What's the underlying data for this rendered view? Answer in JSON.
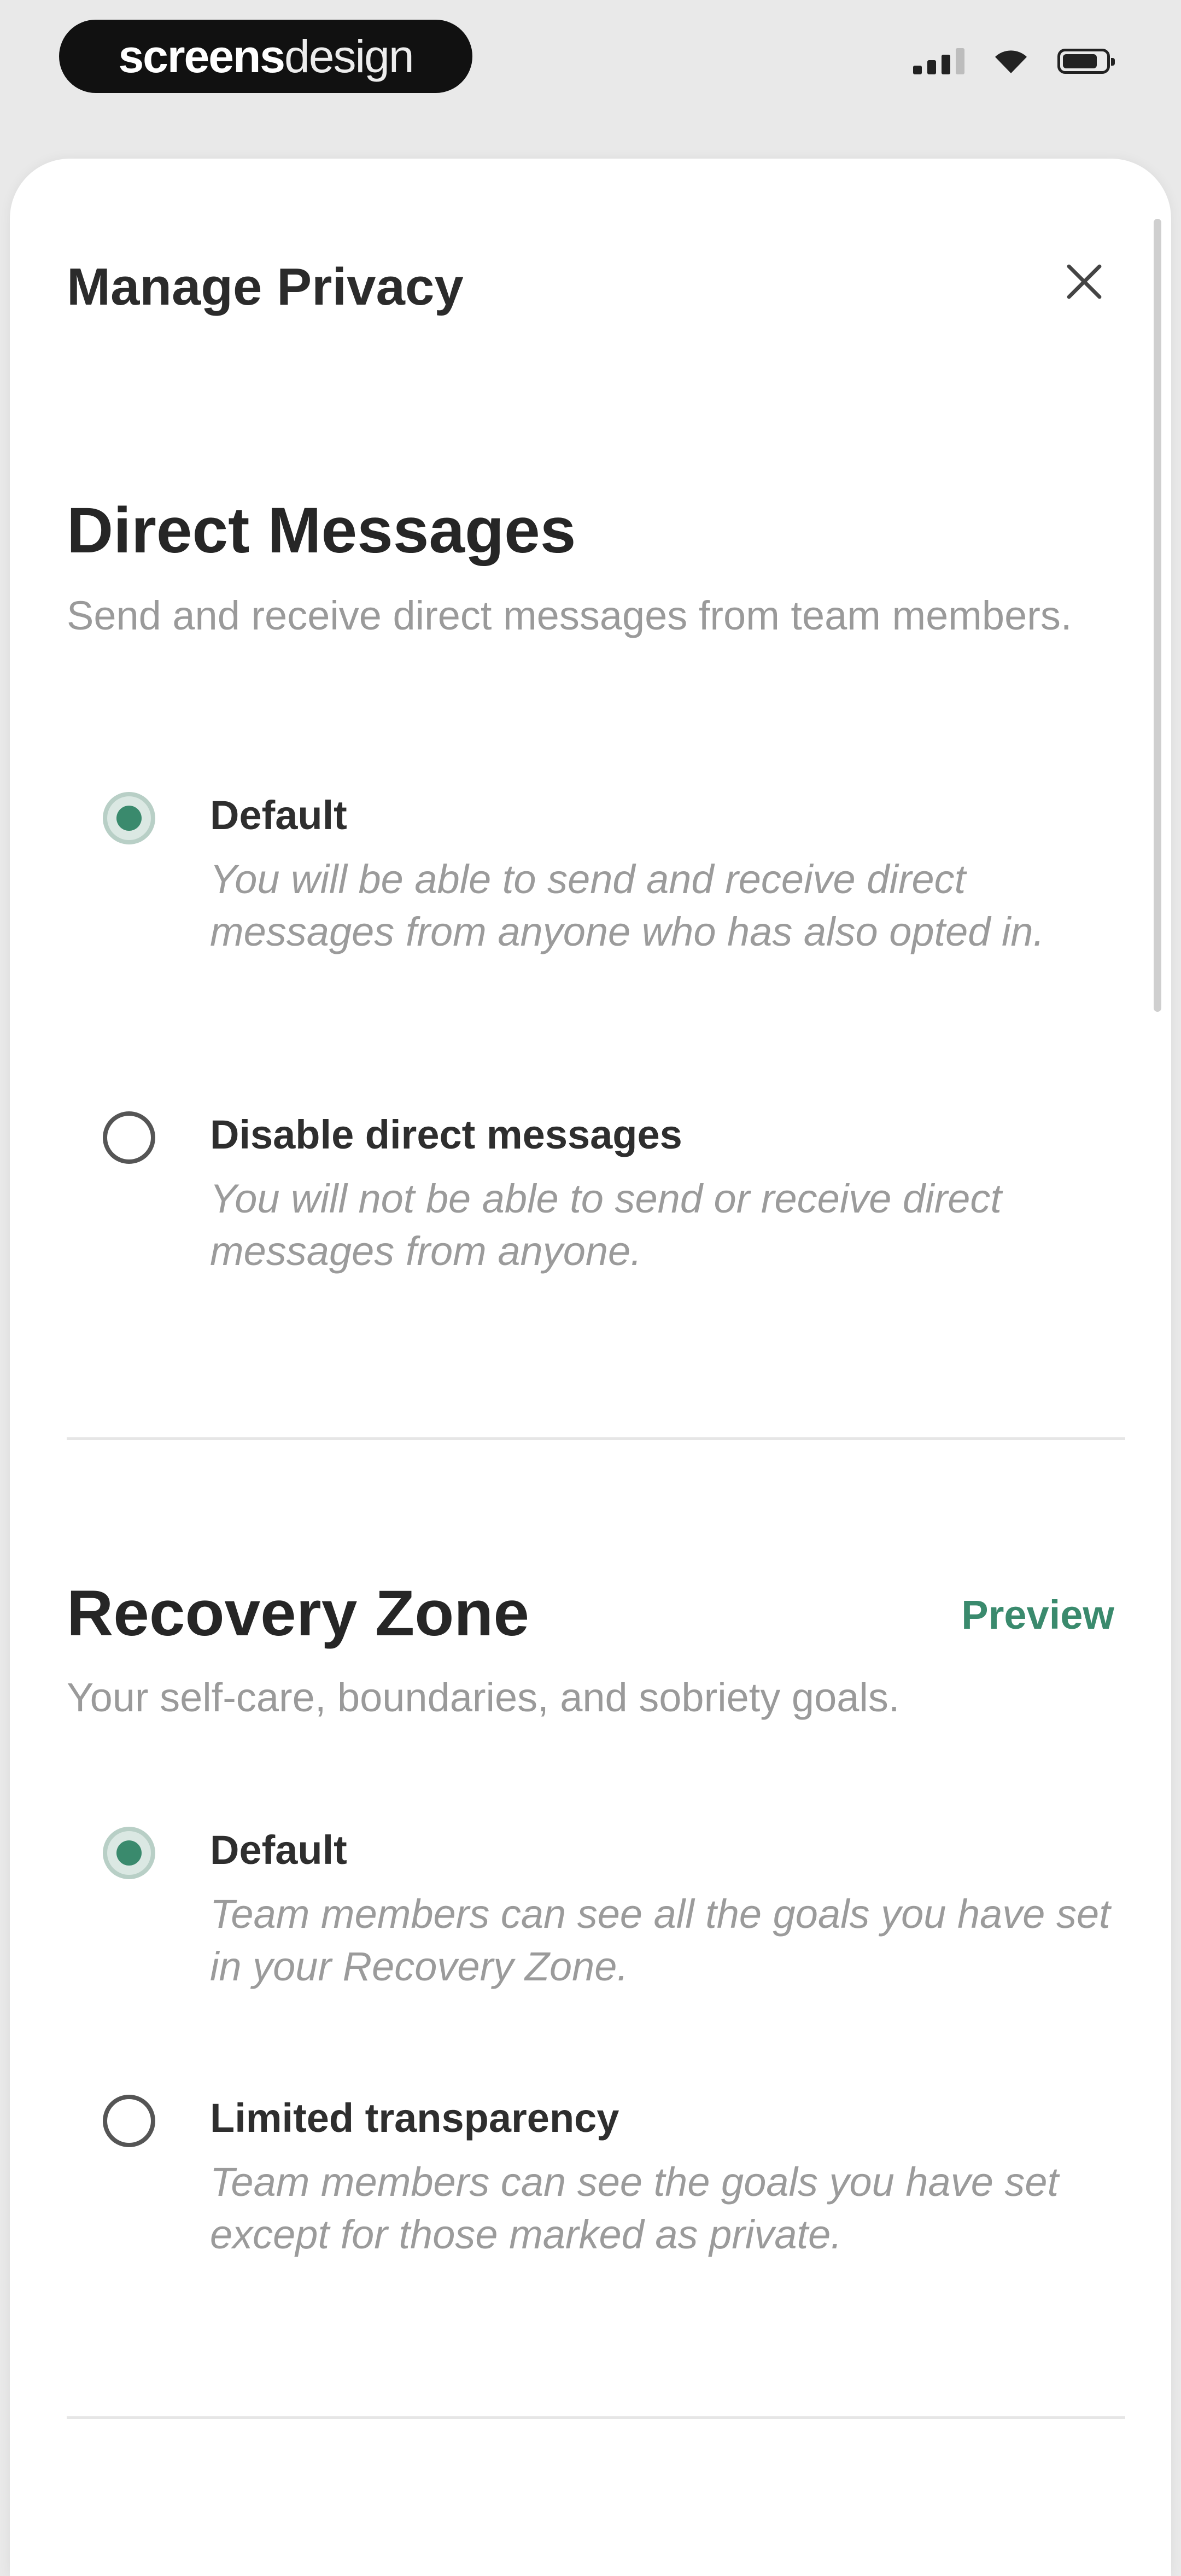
{
  "status_bar": {
    "brand_bold": "screens",
    "brand_light": "design"
  },
  "header": {
    "title": "Manage Privacy",
    "close_icon": "close-icon"
  },
  "sections": [
    {
      "title": "Direct Messages",
      "subtitle": "Send and receive direct messages from team members.",
      "options": [
        {
          "label": "Default",
          "description": "You will be able to send and receive direct messages from anyone who has also opted in.",
          "selected": true
        },
        {
          "label": "Disable direct messages",
          "description": "You will not be able to send or receive direct messages from anyone.",
          "selected": false
        }
      ]
    },
    {
      "title": "Recovery Zone",
      "action": "Preview",
      "subtitle": "Your self-care, boundaries, and sobriety goals.",
      "options": [
        {
          "label": "Default",
          "description": "Team members can see all the goals you have set in your Recovery Zone.",
          "selected": true
        },
        {
          "label": "Limited transparency",
          "description": "Team members can see the goals you have set except for those marked as private.",
          "selected": false
        }
      ]
    }
  ],
  "colors": {
    "accent": "#3a8a6d",
    "background": "#e9e9e9",
    "sheet": "#ffffff"
  }
}
